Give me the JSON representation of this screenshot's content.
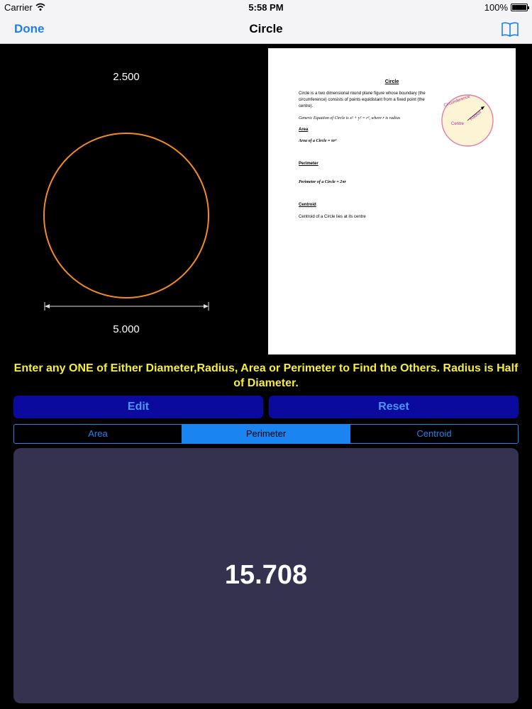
{
  "status": {
    "carrier": "Carrier",
    "time": "5:58 PM",
    "battery": "100%"
  },
  "nav": {
    "done": "Done",
    "title": "Circle"
  },
  "figure": {
    "radius": "2.500",
    "diameter": "5.000",
    "circle_color": "#f28b25"
  },
  "doc": {
    "title": "Circle",
    "intro": [
      "Circle is a two dimensional round plane figure whose boundary (the",
      "circumference) consists of points equidistant from a fixed point (the",
      "centre)."
    ],
    "generic_eq": "Generic Equation of Circle is x² + y² = r², where r is radius",
    "area_heading": "Area",
    "area_eq": "Area of a Circle = πr²",
    "perimeter_heading": "Perimeter",
    "perimeter_eq": "Perimeter of a Circle = 2πr",
    "centroid_heading": "Centroid",
    "centroid_text": "Centroid of a Circle lies at its centre",
    "fig_labels": {
      "circumference": "Circumference",
      "radius": "Radius",
      "centre": "Centre"
    }
  },
  "instruction": "Enter any ONE of Either Diameter,Radius, Area or Perimeter to Find the Others. Radius is Half of Diameter.",
  "buttons": {
    "edit": "Edit",
    "reset": "Reset"
  },
  "tabs": [
    {
      "label": "Area",
      "active": false
    },
    {
      "label": "Perimeter",
      "active": true
    },
    {
      "label": "Centroid",
      "active": false
    }
  ],
  "result": {
    "value": "15.708"
  },
  "colors": {
    "accent": "#1a84f0",
    "instruction": "#f5ee3a",
    "button_bg": "#0b0a9e",
    "result_bg": "#34324e"
  }
}
